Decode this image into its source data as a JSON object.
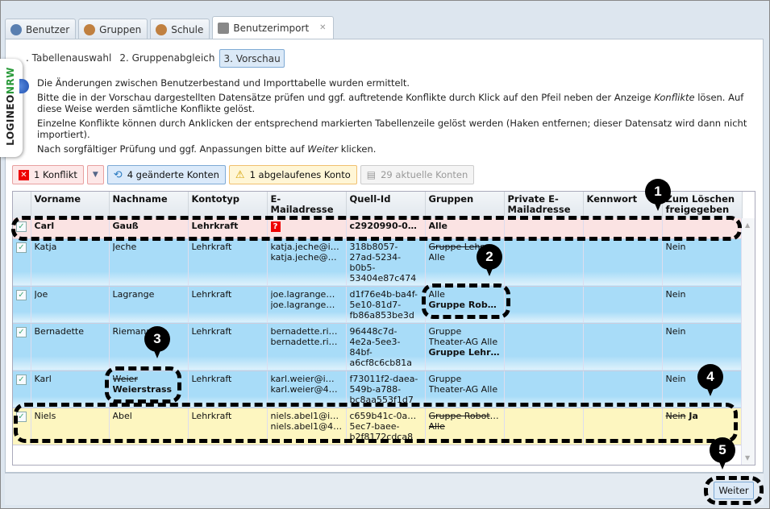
{
  "tabs": [
    {
      "label": "Benutzer",
      "icon": "user-icon"
    },
    {
      "label": "Gruppen",
      "icon": "group-icon"
    },
    {
      "label": "Schule",
      "icon": "school-icon"
    },
    {
      "label": "Benutzerimport",
      "icon": "import-icon",
      "active": true,
      "close": "✕"
    }
  ],
  "logo": {
    "text1": "LOGINEO",
    "text2": "NRW"
  },
  "steps": [
    {
      "label": ". Tabellenauswahl"
    },
    {
      "label": "2. Gruppenabgleich"
    },
    {
      "label": "3. Vorschau",
      "active": true
    }
  ],
  "info": {
    "line1": "Die Änderungen zwischen Benutzerbestand und Importtabelle wurden ermittelt.",
    "line2a": "Bitte die in der Vorschau dargestellten Datensätze prüfen und ggf. auftretende Konflikte durch Klick auf den Pfeil neben der Anzeige ",
    "line2em": "Konflikte",
    "line2b": " lösen. Auf diese Weise werden sämtliche Konflikte gelöst.",
    "line3": "Einzelne Konflikte können durch Anklicken der entsprechend markierten Tabellenzeile gelöst werden (Haken entfernen; dieser Datensatz wird dann nicht importiert).",
    "line4a": "Nach sorgfältiger Prüfung und ggf. Anpassungen bitte auf ",
    "line4em": "Weiter",
    "line4b": " klicken."
  },
  "toolbar": {
    "conflict": "1 Konflikt",
    "changed": "4 geänderte Konten",
    "expired": "1 abgelaufenes Konto",
    "current": "29 aktuelle Konten"
  },
  "colors": {
    "conflict": "#fbe3e3",
    "changed": "#a8dcf8",
    "expired": "#fdf6c0",
    "accent": "#7eaad5"
  },
  "columns": [
    "",
    "Vorname",
    "Nachname",
    "Kontotyp",
    "E-Mailadresse",
    "Quell-Id",
    "Gruppen",
    "Private E-Mailadresse",
    "Kennwort",
    "Zum Löschen freigegeben"
  ],
  "rows": [
    {
      "type": "conflict",
      "checked": true,
      "cells": [
        [
          [
            "Carl",
            ""
          ]
        ],
        [
          [
            "Gauß",
            ""
          ]
        ],
        [
          [
            "Lehrkraft",
            ""
          ]
        ],
        [
          [
            "?",
            "qm"
          ]
        ],
        [
          [
            "c2920990-0…",
            ""
          ]
        ],
        [
          [
            "Alle",
            ""
          ]
        ],
        [],
        [],
        []
      ]
    },
    {
      "type": "changed",
      "checked": true,
      "cells": [
        [
          [
            "Katja",
            ""
          ]
        ],
        [
          [
            "Jeche",
            ""
          ]
        ],
        [
          [
            "Lehrkraft",
            ""
          ]
        ],
        [
          [
            "katja.jeche@i…",
            ""
          ],
          [
            "katja.jeche@4…",
            ""
          ]
        ],
        [
          [
            "318b8057-",
            ""
          ],
          [
            "27ad-5234-",
            ""
          ],
          [
            "b0b5-",
            ""
          ],
          [
            "53404e87c474",
            ""
          ]
        ],
        [
          [
            "Gruppe Lehr…",
            "s"
          ],
          [
            "Alle",
            ""
          ]
        ],
        [],
        [],
        [
          [
            "Nein",
            ""
          ]
        ]
      ]
    },
    {
      "type": "changed",
      "checked": true,
      "cells": [
        [
          [
            "Joe",
            ""
          ]
        ],
        [
          [
            "Lagrange",
            ""
          ]
        ],
        [
          [
            "Lehrkraft",
            ""
          ]
        ],
        [
          [
            "joe.lagrange@…",
            ""
          ],
          [
            "joe.lagrange@…",
            ""
          ]
        ],
        [
          [
            "d1f76e4b-ba4f-",
            ""
          ],
          [
            "5e10-81d7-",
            ""
          ],
          [
            "fb86a853be3d",
            ""
          ]
        ],
        [
          [
            "Alle",
            ""
          ],
          [
            "Gruppe Robo…",
            "b"
          ]
        ],
        [],
        [],
        [
          [
            "Nein",
            ""
          ]
        ]
      ]
    },
    {
      "type": "changed",
      "checked": true,
      "cells": [
        [
          [
            "Bernadette",
            ""
          ]
        ],
        [
          [
            "Riemann",
            ""
          ]
        ],
        [
          [
            "Lehrkraft",
            ""
          ]
        ],
        [
          [
            "bernadette.rie…",
            ""
          ],
          [
            "bernadette.rie…",
            ""
          ]
        ],
        [
          [
            "96448c7d-",
            ""
          ],
          [
            "4e2a-5ee3-",
            ""
          ],
          [
            "84bf-",
            ""
          ],
          [
            "a6cf8c6cb81a",
            ""
          ]
        ],
        [
          [
            "Gruppe",
            ""
          ],
          [
            "Theater-AG Alle",
            ""
          ],
          [
            "Gruppe Lehr…",
            "b"
          ]
        ],
        [],
        [],
        [
          [
            "Nein",
            ""
          ]
        ]
      ]
    },
    {
      "type": "changed",
      "checked": true,
      "cells": [
        [
          [
            "Karl",
            ""
          ]
        ],
        [
          [
            "Weier",
            "s"
          ],
          [
            "Weierstrass",
            "b"
          ]
        ],
        [
          [
            "Lehrkraft",
            ""
          ]
        ],
        [
          [
            "karl.weier@im…",
            ""
          ],
          [
            "karl.weier@40…",
            ""
          ]
        ],
        [
          [
            "f73011f2-daea-",
            ""
          ],
          [
            "549b-a788-",
            ""
          ],
          [
            "bc8aa553f1d7",
            ""
          ]
        ],
        [
          [
            "Gruppe",
            ""
          ],
          [
            "Theater-AG Alle",
            ""
          ]
        ],
        [],
        [],
        [
          [
            "Nein",
            ""
          ]
        ]
      ]
    },
    {
      "type": "expired",
      "checked": true,
      "cells": [
        [
          [
            "Niels",
            ""
          ]
        ],
        [
          [
            "Abel",
            ""
          ]
        ],
        [
          [
            "Lehrkraft",
            ""
          ]
        ],
        [
          [
            "niels.abel1@i…",
            ""
          ],
          [
            "niels.abel1@4…",
            ""
          ]
        ],
        [
          [
            "c659b41c-0a84-",
            ""
          ],
          [
            "5ec7-baee-",
            ""
          ],
          [
            "b2f8172cdca8",
            ""
          ]
        ],
        [
          [
            "Gruppe Roboti…",
            "s"
          ],
          [
            "Alle",
            "s"
          ]
        ],
        [],
        [],
        [
          [
            "Nein",
            "s"
          ],
          [
            " Ja",
            "b"
          ]
        ]
      ]
    }
  ],
  "footer": {
    "next": "Weiter"
  },
  "callouts": [
    "1",
    "2",
    "3",
    "4",
    "5"
  ]
}
